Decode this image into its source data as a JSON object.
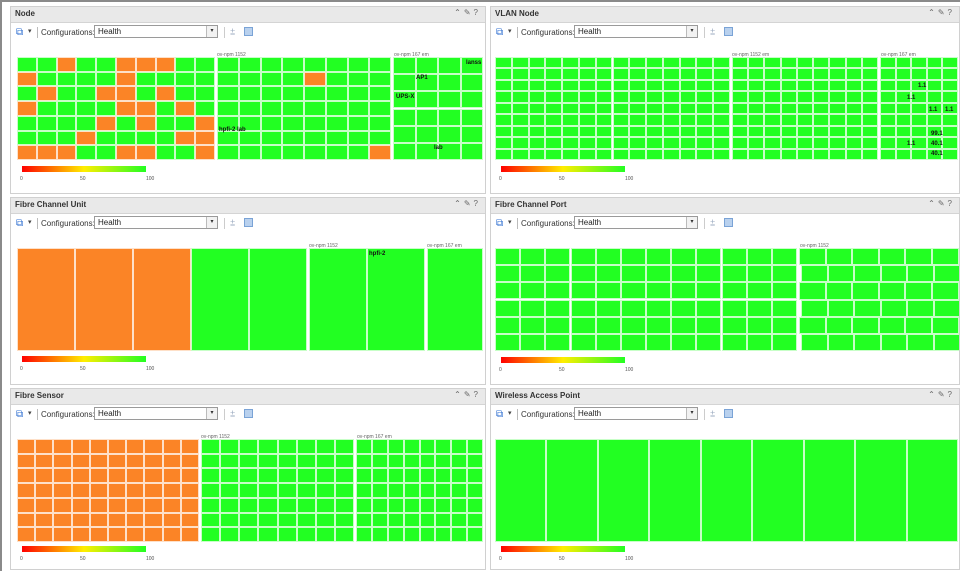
{
  "toolbar": {
    "config_label": "Configurations:",
    "config_value": "Health",
    "dropdown_glyph": "▾"
  },
  "panel_controls": {
    "collapse": "⌃",
    "edit": "✎",
    "help": "?"
  },
  "legend": {
    "t0": "0",
    "t50": "50",
    "t100": "100",
    "gradient": [
      "#ff0000",
      "#ffee00",
      "#22ff22"
    ]
  },
  "colors": {
    "healthy": "#22ff22",
    "degraded": "#fb8426"
  },
  "panels": {
    "node": {
      "title": "Node",
      "groups": [
        "ov-npm 1152",
        "ov-npm 167 em"
      ],
      "cell_labels": [
        "lanss",
        "AP1",
        "UPS-X",
        "hpfi-2 lab",
        "lab"
      ]
    },
    "vlan": {
      "title": "VLAN Node",
      "groups": [
        "ov-npm 1152 em",
        "ov-npm 167 em"
      ],
      "cell_labels": [
        "1.1",
        "1.1",
        "1.1",
        "1.1",
        "99.1",
        "40.1",
        "1.1",
        "40.1"
      ]
    },
    "fcu": {
      "title": "Fibre Channel Unit",
      "groups": [
        "ov-npm 1152",
        "ov-npm 167 em"
      ],
      "cell_labels": [
        "hpfi-2"
      ]
    },
    "fcp": {
      "title": "Fibre Channel Port",
      "groups": [
        "ov-npm 1152"
      ],
      "cell_labels": []
    },
    "fs": {
      "title": "Fibre Sensor",
      "groups": [
        "ov-npm 1152",
        "ov-npm 167 em"
      ],
      "cell_labels": []
    },
    "wap": {
      "title": "Wireless Access Point",
      "groups": [],
      "cell_labels": []
    }
  }
}
